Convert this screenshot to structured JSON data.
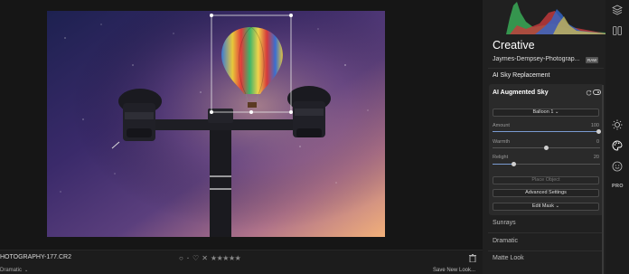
{
  "canvas": {
    "filename": "HOTOGRAPHY-177.CR2",
    "current_preset": "Dramatic",
    "rating_stars": [
      "★",
      "★",
      "★",
      "★",
      "★"
    ],
    "flag_reject": "✕",
    "save_look_label": "Save New Look..."
  },
  "panel": {
    "title": "Creative",
    "preset_file": "Jaymes-Dempsey-Photograp...",
    "raw_badge": "RAW",
    "section_sky_replacement": "AI Sky Replacement",
    "card": {
      "title": "AI Augmented Sky",
      "object_select": "Balloon 1",
      "sliders": [
        {
          "label": "Amount",
          "value": "100",
          "fraction": 1.0
        },
        {
          "label": "Warmth",
          "value": "0",
          "fraction": 0.5
        },
        {
          "label": "Relight",
          "value": "20",
          "fraction": 0.2
        }
      ],
      "place_object_label": "Place Object",
      "advanced_settings_label": "Advanced Settings",
      "edit_mask_label": "Edit Mask"
    },
    "sections": [
      "Sunrays",
      "Dramatic",
      "Matte Look"
    ]
  },
  "rail": {
    "pro_label": "PRO"
  },
  "colors": {
    "accent_slider": "#7a9bd1",
    "panel_bg": "#202020",
    "card_bg": "#2a2a2a"
  }
}
